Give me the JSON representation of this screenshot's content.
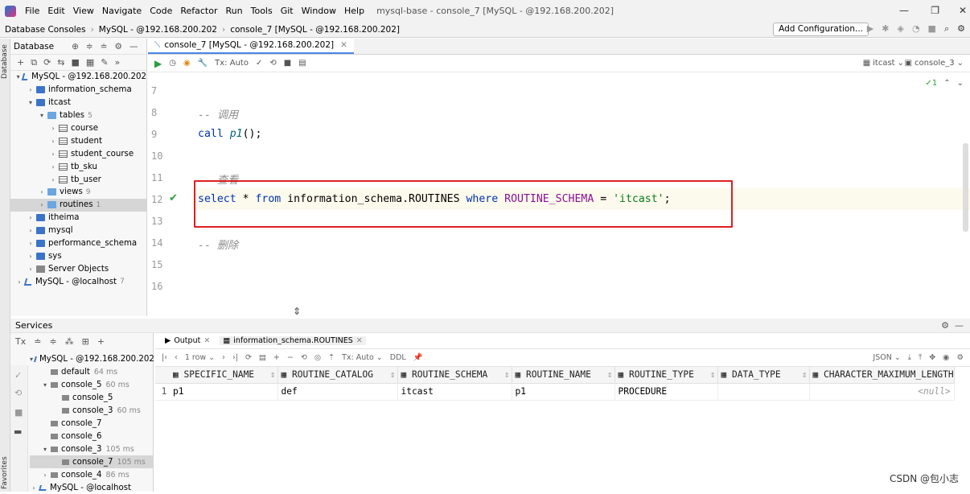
{
  "menubar": {
    "items": [
      "File",
      "Edit",
      "View",
      "Navigate",
      "Code",
      "Refactor",
      "Run",
      "Tools",
      "Git",
      "Window",
      "Help"
    ],
    "title": "mysql-base - console_7 [MySQL - @192.168.200.202]"
  },
  "navbar": {
    "crumbs": [
      "Database Consoles",
      "MySQL - @192.168.200.202",
      "console_7 [MySQL - @192.168.200.202]"
    ],
    "add_config": "Add Configuration..."
  },
  "sidebar": {
    "strip_label": "Database",
    "favorites_label": "Favorites",
    "panel_title": "Database",
    "tree": [
      {
        "label": "MySQL - @192.168.200.202",
        "count": "",
        "indent": 0,
        "icon": "conn",
        "arrow": "▾"
      },
      {
        "label": "information_schema",
        "count": "",
        "indent": 1,
        "icon": "db",
        "arrow": "›"
      },
      {
        "label": "itcast",
        "count": "",
        "indent": 1,
        "icon": "db",
        "arrow": "▾"
      },
      {
        "label": "tables",
        "count": "5",
        "indent": 2,
        "icon": "folder",
        "arrow": "▾"
      },
      {
        "label": "course",
        "count": "",
        "indent": 3,
        "icon": "table",
        "arrow": "›"
      },
      {
        "label": "student",
        "count": "",
        "indent": 3,
        "icon": "table",
        "arrow": "›"
      },
      {
        "label": "student_course",
        "count": "",
        "indent": 3,
        "icon": "table",
        "arrow": "›"
      },
      {
        "label": "tb_sku",
        "count": "",
        "indent": 3,
        "icon": "table",
        "arrow": "›"
      },
      {
        "label": "tb_user",
        "count": "",
        "indent": 3,
        "icon": "table",
        "arrow": "›"
      },
      {
        "label": "views",
        "count": "9",
        "indent": 2,
        "icon": "folder",
        "arrow": "›"
      },
      {
        "label": "routines",
        "count": "1",
        "indent": 2,
        "icon": "folder",
        "arrow": "›",
        "selected": true
      },
      {
        "label": "itheima",
        "count": "",
        "indent": 1,
        "icon": "db",
        "arrow": "›"
      },
      {
        "label": "mysql",
        "count": "",
        "indent": 1,
        "icon": "db",
        "arrow": "›"
      },
      {
        "label": "performance_schema",
        "count": "",
        "indent": 1,
        "icon": "db",
        "arrow": "›"
      },
      {
        "label": "sys",
        "count": "",
        "indent": 1,
        "icon": "db",
        "arrow": "›"
      },
      {
        "label": "Server Objects",
        "count": "",
        "indent": 1,
        "icon": "server",
        "arrow": "›"
      },
      {
        "label": "MySQL - @localhost",
        "count": "7",
        "indent": 0,
        "icon": "conn",
        "arrow": "›"
      }
    ]
  },
  "editor": {
    "tab_label": "console_7 [MySQL - @192.168.200.202]",
    "tx_mode": "Tx: Auto",
    "right_db": "itcast",
    "right_console": "console_3",
    "inspection_count": "1",
    "lines": [
      {
        "n": "7"
      },
      {
        "n": "8",
        "comment": "-- 调用"
      },
      {
        "n": "9",
        "call_kw": "call",
        "call_fn": "p1",
        "call_rest": "();"
      },
      {
        "n": "10"
      },
      {
        "n": "11",
        "comment": "-- 查看"
      },
      {
        "n": "12",
        "sql": true
      },
      {
        "n": "13"
      },
      {
        "n": "14",
        "comment": "-- 删除"
      },
      {
        "n": "15"
      },
      {
        "n": "16"
      }
    ],
    "sql": {
      "select": "select",
      "star": " * ",
      "from": "from",
      "table": " information_schema.ROUTINES ",
      "where": "where",
      "col": " ROUTINE_SCHEMA",
      "eq": " = ",
      "str": "'itcast'",
      "end": ";"
    }
  },
  "services": {
    "title": "Services",
    "tree": [
      {
        "label": "MySQL - @192.168.200.202",
        "time": "",
        "indent": 0,
        "arrow": "▾"
      },
      {
        "label": "default",
        "time": "64 ms",
        "indent": 1,
        "arrow": ""
      },
      {
        "label": "console_5",
        "time": "60 ms",
        "indent": 1,
        "arrow": "▾"
      },
      {
        "label": "console_5",
        "time": "",
        "indent": 2,
        "arrow": ""
      },
      {
        "label": "console_3",
        "time": "60 ms",
        "indent": 2,
        "arrow": ""
      },
      {
        "label": "console_7",
        "time": "",
        "indent": 1,
        "arrow": ""
      },
      {
        "label": "console_6",
        "time": "",
        "indent": 1,
        "arrow": ""
      },
      {
        "label": "console_3",
        "time": "105 ms",
        "indent": 1,
        "arrow": "▾"
      },
      {
        "label": "console_7",
        "time": "105 ms",
        "indent": 2,
        "arrow": "",
        "selected": true
      },
      {
        "label": "console_4",
        "time": "86 ms",
        "indent": 1,
        "arrow": "›"
      },
      {
        "label": "MySQL - @localhost",
        "time": "",
        "indent": 0,
        "arrow": "›"
      }
    ],
    "tabs": [
      "Output",
      "information_schema.ROUTINES"
    ],
    "grid_tools": {
      "rows": "1 row",
      "tx": "Tx: Auto",
      "ddl": "DDL",
      "format": "JSON"
    },
    "columns": [
      "SPECIFIC_NAME",
      "ROUTINE_CATALOG",
      "ROUTINE_SCHEMA",
      "ROUTINE_NAME",
      "ROUTINE_TYPE",
      "DATA_TYPE",
      "CHARACTER_MAXIMUM_LENGTH"
    ],
    "rows": [
      {
        "num": "1",
        "cells": [
          "p1",
          "def",
          "itcast",
          "p1",
          "PROCEDURE",
          "",
          "<null>"
        ]
      }
    ]
  },
  "watermark": "CSDN @包小志"
}
